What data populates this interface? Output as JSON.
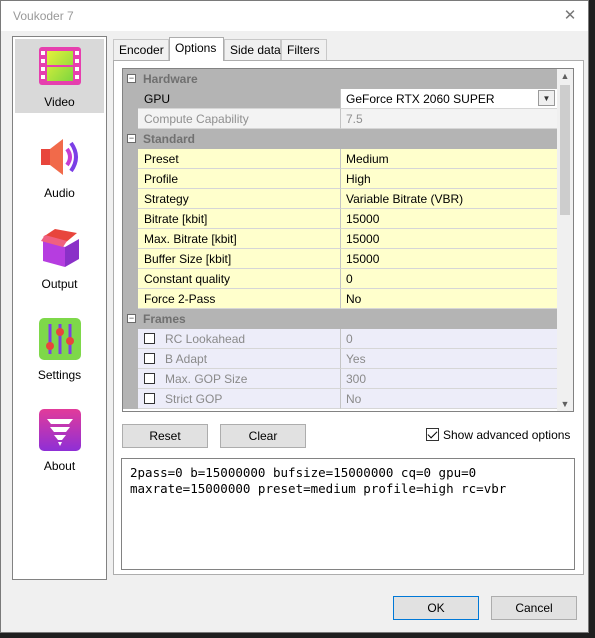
{
  "window": {
    "title": "Voukoder 7"
  },
  "sidebar": {
    "items": [
      {
        "label": "Video",
        "active": true,
        "icon": "film-strip-icon"
      },
      {
        "label": "Audio",
        "active": false,
        "icon": "speaker-icon"
      },
      {
        "label": "Output",
        "active": false,
        "icon": "package-box-icon"
      },
      {
        "label": "Settings",
        "active": false,
        "icon": "sliders-icon"
      },
      {
        "label": "About",
        "active": false,
        "icon": "tornado-logo-icon"
      }
    ]
  },
  "tabs": [
    "Encoder",
    "Options",
    "Side data",
    "Filters"
  ],
  "active_tab": "Options",
  "property_grid": {
    "hardware": {
      "title": "Hardware",
      "gpu": {
        "name": "GPU",
        "value": "GeForce RTX 2060 SUPER"
      },
      "compute": {
        "name": "Compute Capability",
        "value": "7.5"
      }
    },
    "standard": {
      "title": "Standard",
      "rows": [
        {
          "name": "Preset",
          "value": "Medium"
        },
        {
          "name": "Profile",
          "value": "High"
        },
        {
          "name": "Strategy",
          "value": "Variable Bitrate (VBR)"
        },
        {
          "name": "Bitrate [kbit]",
          "value": "15000"
        },
        {
          "name": "Max. Bitrate [kbit]",
          "value": "15000"
        },
        {
          "name": "Buffer Size [kbit]",
          "value": "15000"
        },
        {
          "name": "Constant quality",
          "value": "0"
        },
        {
          "name": "Force 2-Pass",
          "value": "No"
        }
      ]
    },
    "frames": {
      "title": "Frames",
      "rows": [
        {
          "name": "RC Lookahead",
          "value": "0",
          "checked": false
        },
        {
          "name": "B Adapt",
          "value": "Yes",
          "checked": false
        },
        {
          "name": "Max. GOP Size",
          "value": "300",
          "checked": false
        },
        {
          "name": "Strict GOP",
          "value": "No",
          "checked": false
        }
      ]
    }
  },
  "buttons": {
    "reset": "Reset",
    "clear": "Clear",
    "ok": "OK",
    "cancel": "Cancel"
  },
  "show_advanced": {
    "label": "Show advanced options",
    "checked": true
  },
  "command_preview": {
    "line1": "2pass=0 b=15000000 bufsize=15000000 cq=0 gpu=0",
    "line2": "maxrate=15000000 preset=medium profile=high rc=vbr"
  },
  "colors": {
    "highlight_row": "#ffffcc",
    "category_bar": "#b4b4b4",
    "disabled_row": "#ededf9"
  }
}
